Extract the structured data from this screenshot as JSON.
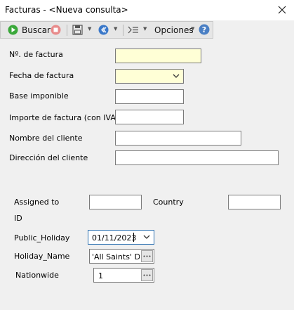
{
  "window": {
    "title": "Facturas - <Nueva consulta>"
  },
  "toolbar": {
    "search_label": "Buscar",
    "options_label": "Opciones"
  },
  "form": {
    "invoice_number_label": "Nº. de factura",
    "invoice_date_label": "Fecha de factura",
    "tax_base_label": "Base imponible",
    "invoice_amount_label": "Importe de factura (con IVA)",
    "customer_name_label": "Nombre del cliente",
    "customer_address_label": "Dirección del cliente",
    "assigned_to_label_line1": "Assigned to",
    "assigned_to_label_line2": "ID",
    "country_label": "Country",
    "public_holiday_label": "Public_Holiday",
    "public_holiday_value": "01/11/2023",
    "holiday_name_label": "Holiday_Name",
    "holiday_name_value": "'All Saints' Da",
    "nationwide_label": "Nationwide",
    "nationwide_value": "1"
  },
  "colors": {
    "highlight_field": "#ffffd6",
    "focus_border": "#2a6fb0"
  }
}
